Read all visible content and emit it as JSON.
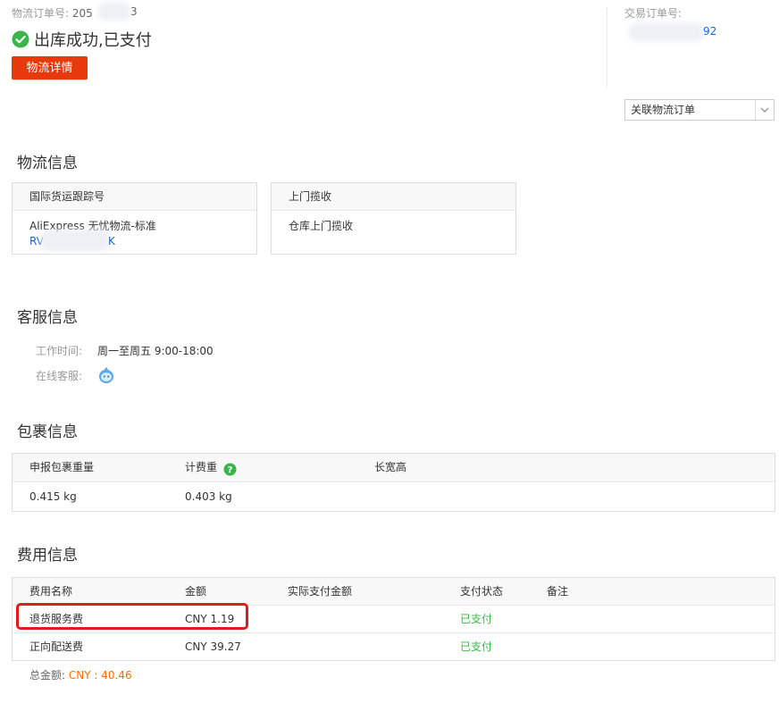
{
  "header": {
    "logistics_order_label": "物流订单号:",
    "logistics_order_prefix": "205",
    "logistics_order_suffix": "3",
    "status_text": "出库成功,已支付",
    "details_button": "物流详情",
    "trade_order_label": "交易订单号:",
    "trade_order_suffix": "92",
    "related_select_value": "关联物流订单"
  },
  "logistics": {
    "title": "物流信息",
    "tracking_card": {
      "header": "国际货运跟踪号",
      "service": "AliExpress 无忧物流-标准",
      "tracking_prefix": "RV",
      "tracking_suffix": "K"
    },
    "pickup_card": {
      "header": "上门揽收",
      "value": "仓库上门揽收"
    }
  },
  "customer_service": {
    "title": "客服信息",
    "hours_label": "工作时间:",
    "hours_value": "周一至周五 9:00-18:00",
    "online_label": "在线客服:"
  },
  "package": {
    "title": "包裹信息",
    "columns": [
      "申报包裹重量",
      "计费重",
      "长宽高"
    ],
    "values": [
      "0.415 kg",
      "0.403 kg",
      ""
    ]
  },
  "fees": {
    "title": "费用信息",
    "columns": [
      "费用名称",
      "金额",
      "实际支付金额",
      "支付状态",
      "备注"
    ],
    "rows": [
      {
        "name": "退货服务费",
        "amount": "CNY 1.19",
        "actual": "",
        "status": "已支付",
        "note": ""
      },
      {
        "name": "正向配送费",
        "amount": "CNY 39.27",
        "actual": "",
        "status": "已支付",
        "note": ""
      }
    ],
    "total_label": "总金额:",
    "total_value": "CNY : 40.46"
  },
  "colors": {
    "primary_red": "#e8380d",
    "success_green": "#3ab549",
    "total_orange": "#ff6a00",
    "link_blue": "#1a66c8",
    "highlight_red": "#e01c1c"
  }
}
